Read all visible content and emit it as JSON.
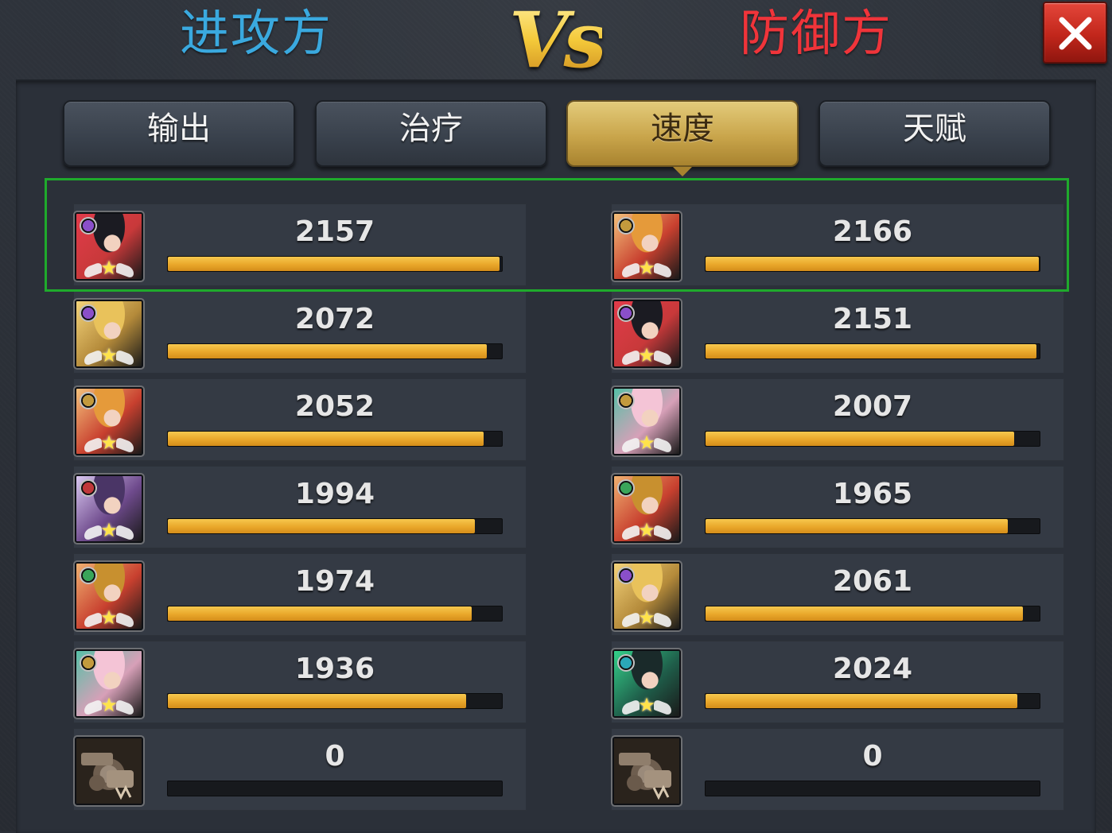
{
  "header": {
    "attacker_title": "进攻方",
    "vs_label": "Vs",
    "defender_title": "防御方",
    "close_icon": "close-icon"
  },
  "tabs": [
    {
      "label": "输出",
      "active": false
    },
    {
      "label": "治疗",
      "active": false
    },
    {
      "label": "速度",
      "active": true
    },
    {
      "label": "天赋",
      "active": false
    }
  ],
  "max_value": 2166,
  "colors": {
    "attacker": "#3aa9df",
    "defender": "#f0343a",
    "bar": "#e9a72a",
    "highlight": "#1faa2c",
    "close": "#c1261b"
  },
  "attackers": [
    {
      "value": "2157",
      "faction": "#8a4fc9",
      "portrait": "#c8393a",
      "hair": "#1b1b22",
      "accent": "#e23b4a"
    },
    {
      "value": "2072",
      "faction": "#8a4fc9",
      "portrait": "#b48a3a",
      "hair": "#e9c25b",
      "accent": "#f4d37a"
    },
    {
      "value": "2052",
      "faction": "#c39a3d",
      "portrait": "#c8402f",
      "hair": "#e59a3a",
      "accent": "#f4c07a"
    },
    {
      "value": "1994",
      "faction": "#c0383a",
      "portrait": "#6e4a8c",
      "hair": "#4a3566",
      "accent": "#d9c7f0"
    },
    {
      "value": "1974",
      "faction": "#3aa55a",
      "portrait": "#c8402f",
      "hair": "#c8902f",
      "accent": "#f0b070"
    },
    {
      "value": "1936",
      "faction": "#c39a3d",
      "portrait": "#d7a0b8",
      "hair": "#f4c4d6",
      "accent": "#57c0a7"
    },
    {
      "value": "0",
      "faction": "",
      "portrait": "#4a3c2f",
      "hair": "#9a8a7a",
      "accent": "#6e5e4f",
      "mech": true
    }
  ],
  "defenders": [
    {
      "value": "2166",
      "faction": "#c39a3d",
      "portrait": "#c8402f",
      "hair": "#e59a3a",
      "accent": "#f4c07a"
    },
    {
      "value": "2151",
      "faction": "#8a4fc9",
      "portrait": "#c8393a",
      "hair": "#1b1b22",
      "accent": "#e23b4a"
    },
    {
      "value": "2007",
      "faction": "#c39a3d",
      "portrait": "#d7a0b8",
      "hair": "#f4c4d6",
      "accent": "#57c0a7"
    },
    {
      "value": "1965",
      "faction": "#3aa55a",
      "portrait": "#c8402f",
      "hair": "#c8902f",
      "accent": "#f0b070"
    },
    {
      "value": "2061",
      "faction": "#8a4fc9",
      "portrait": "#b48a3a",
      "hair": "#e9c25b",
      "accent": "#f4d37a"
    },
    {
      "value": "2024",
      "faction": "#2ba7b8",
      "portrait": "#1f5e4a",
      "hair": "#1a2a2a",
      "accent": "#34d08a"
    },
    {
      "value": "0",
      "faction": "",
      "portrait": "#4a3c2f",
      "hair": "#9a8a7a",
      "accent": "#6e5e4f",
      "mech": true
    }
  ]
}
